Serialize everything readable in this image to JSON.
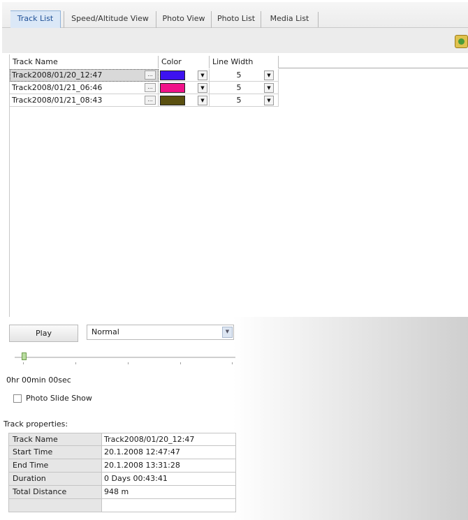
{
  "tabs": [
    {
      "label": "Track List",
      "active": true
    },
    {
      "label": "Speed/Altitude View",
      "active": false
    },
    {
      "label": "Photo View",
      "active": false
    },
    {
      "label": "Photo List",
      "active": false
    },
    {
      "label": "Media List",
      "active": false
    }
  ],
  "toolbar": {
    "icon": "export-icon"
  },
  "grid": {
    "columns": [
      "Track Name",
      "Color",
      "Line Width"
    ],
    "rows": [
      {
        "name": "Track2008/01/20_12:47",
        "color": "#3d12f0",
        "width": "5",
        "selected": true
      },
      {
        "name": "Track2008/01/21_06:46",
        "color": "#f01289",
        "width": "5",
        "selected": false
      },
      {
        "name": "Track2008/01/21_08:43",
        "color": "#5a5010",
        "width": "5",
        "selected": false
      }
    ],
    "ellipsis": "..."
  },
  "player": {
    "play_label": "Play",
    "speed_value": "Normal",
    "slider_position": 0.0,
    "elapsed": "0hr 00min 00sec",
    "slide_show_label": "Photo Slide Show",
    "slide_show_checked": false
  },
  "properties": {
    "title": "Track properties:",
    "rows": [
      {
        "key": "Track Name",
        "value": "Track2008/01/20_12:47"
      },
      {
        "key": "Start Time",
        "value": "20.1.2008 12:47:47"
      },
      {
        "key": "End Time",
        "value": "20.1.2008 13:31:28"
      },
      {
        "key": "Duration",
        "value": "0 Days  00:43:41"
      },
      {
        "key": "Total Distance",
        "value": "948 m"
      },
      {
        "key": "",
        "value": ""
      }
    ]
  }
}
